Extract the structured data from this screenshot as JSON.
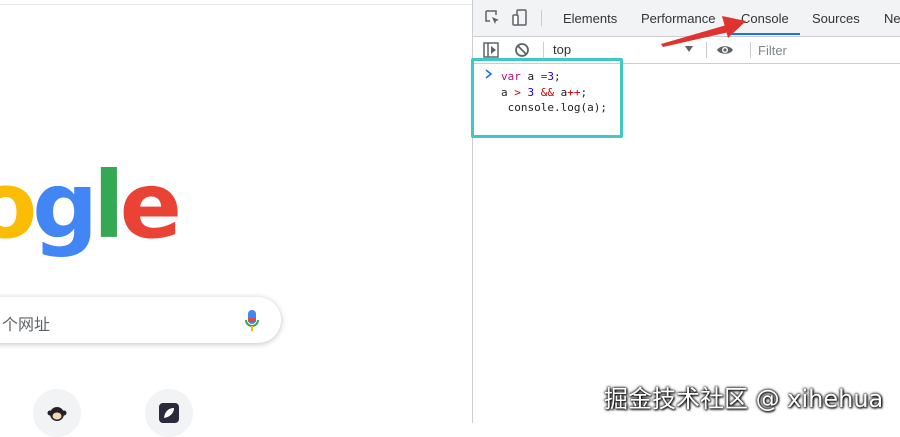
{
  "google": {
    "logo_letters": [
      "o",
      "g",
      "l",
      "e"
    ],
    "logo_colors": [
      "#fbbc05",
      "#4285f4",
      "#34a853",
      "#ea4335"
    ],
    "search_placeholder": "个网址",
    "mic_icon": "microphone-icon",
    "shortcuts": [
      "monkey-avatar-icon",
      "leaf-icon"
    ]
  },
  "devtools": {
    "tabs": [
      "Elements",
      "Performance",
      "Console",
      "Sources",
      "Ne"
    ],
    "active_tab": "Console",
    "context": "top",
    "filter_placeholder": "Filter",
    "accent_color": "#1a73e8",
    "code_lines": [
      {
        "parts": [
          {
            "t": "var",
            "c": "kw"
          },
          {
            "t": " a ",
            "c": ""
          },
          {
            "t": "=",
            "c": "op"
          },
          {
            "t": "3",
            "c": "num"
          },
          {
            "t": ";",
            "c": ""
          }
        ]
      },
      {
        "parts": [
          {
            "t": "a ",
            "c": ""
          },
          {
            "t": ">",
            "c": "op"
          },
          {
            "t": " ",
            "c": ""
          },
          {
            "t": "3",
            "c": "num"
          },
          {
            "t": " ",
            "c": ""
          },
          {
            "t": "&&",
            "c": "op"
          },
          {
            "t": " a",
            "c": ""
          },
          {
            "t": "++",
            "c": "op"
          },
          {
            "t": ";",
            "c": ""
          }
        ]
      },
      {
        "parts": [
          {
            "t": " console.log(a);",
            "c": ""
          }
        ]
      }
    ]
  },
  "annotation": {
    "highlight_color": "#3ec8c7",
    "arrow_color": "#e0322f"
  },
  "watermark": "掘金技术社区 @ xihehua"
}
